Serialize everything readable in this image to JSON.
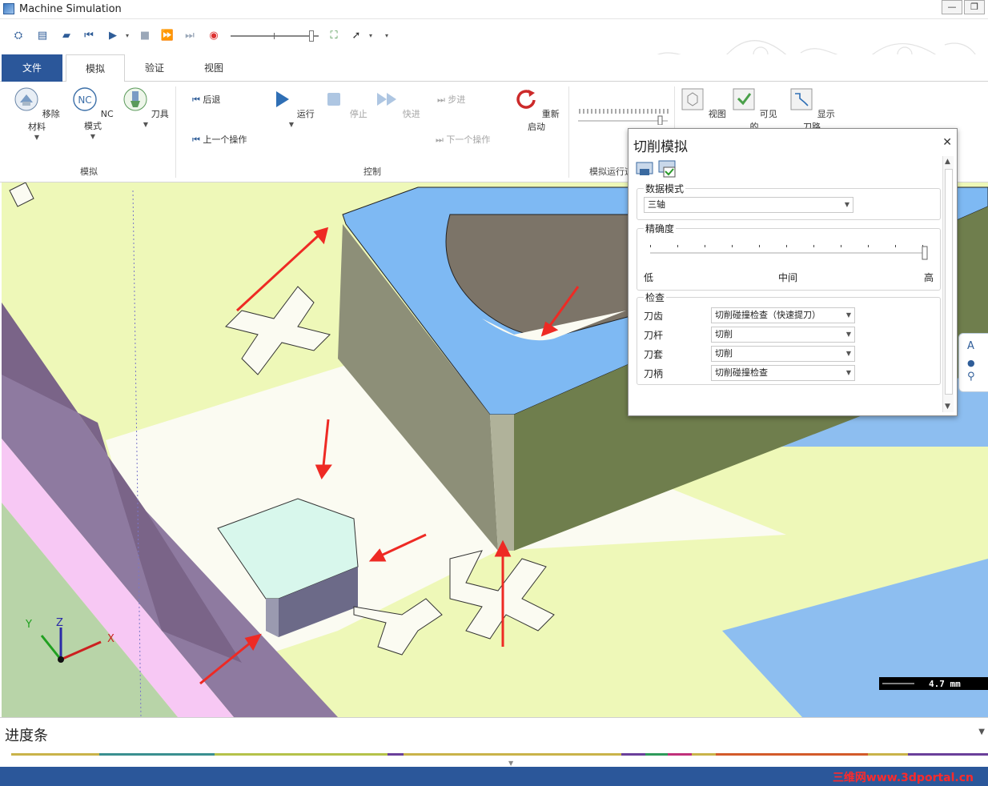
{
  "window": {
    "title": "Machine Simulation"
  },
  "ribbon_tabs": [
    {
      "label": "文件"
    },
    {
      "label": "模拟"
    },
    {
      "label": "验证"
    },
    {
      "label": "视图"
    }
  ],
  "ribbon": {
    "simulate_group": {
      "label": "模拟",
      "remove_material": "移除材料",
      "nc_mode": "NC 模式",
      "nc_icon_text": "NC",
      "tool": "刀具"
    },
    "control_group": {
      "label": "控制",
      "back": "后退",
      "previous_op": "上一个操作",
      "run": "运行",
      "stop": "停止",
      "fast_forward": "快进",
      "step": "步进",
      "next_op": "下一个操作",
      "restart": "重新启动"
    },
    "run_group": {
      "label": "模拟运行速"
    },
    "view_buttons": {
      "view": "视图",
      "visible": "可见的",
      "show_path": "显示刀路"
    }
  },
  "panel": {
    "title": "切削模拟",
    "data_mode": {
      "legend": "数据模式",
      "value": "三轴"
    },
    "accuracy": {
      "legend": "精确度",
      "low": "低",
      "mid": "中间",
      "high": "高",
      "level": 1.0
    },
    "check": {
      "legend": "检查",
      "rows": [
        {
          "label": "刀齿",
          "value": "切削碰撞检查（快速提刀）"
        },
        {
          "label": "刀杆",
          "value": "切削"
        },
        {
          "label": "刀套",
          "value": "切削"
        },
        {
          "label": "刀柄",
          "value": "切削碰撞检查"
        }
      ]
    }
  },
  "viewport": {
    "axis_labels": {
      "x": "X",
      "y": "Y",
      "z": "Z"
    },
    "scale_label": "4.7 mm"
  },
  "progress": {
    "label": "进度条"
  },
  "watermark": "三维网www.3dportal.cn",
  "colors": {
    "file_tab": "#2b579a",
    "status_bar": "#2b579a",
    "arrow": "#ee2a24",
    "stock_top": "#eef8b8",
    "part_blue": "#7eb9f3",
    "wall_olive": "#6f7e4d"
  }
}
